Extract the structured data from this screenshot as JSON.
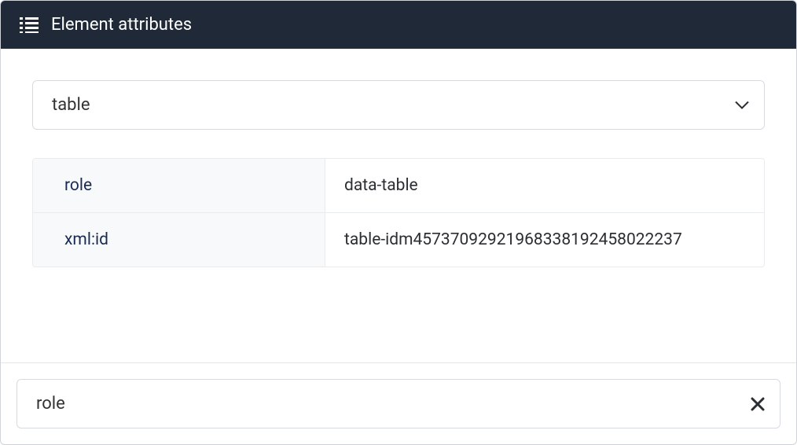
{
  "header": {
    "title": "Element attributes"
  },
  "selector": {
    "selected": "table"
  },
  "attributes": [
    {
      "key": "role",
      "value": "data-table"
    },
    {
      "key": "xml:id",
      "value": "table-idm45737092921968338192458022237"
    }
  ],
  "footer_input": {
    "value": "role"
  }
}
